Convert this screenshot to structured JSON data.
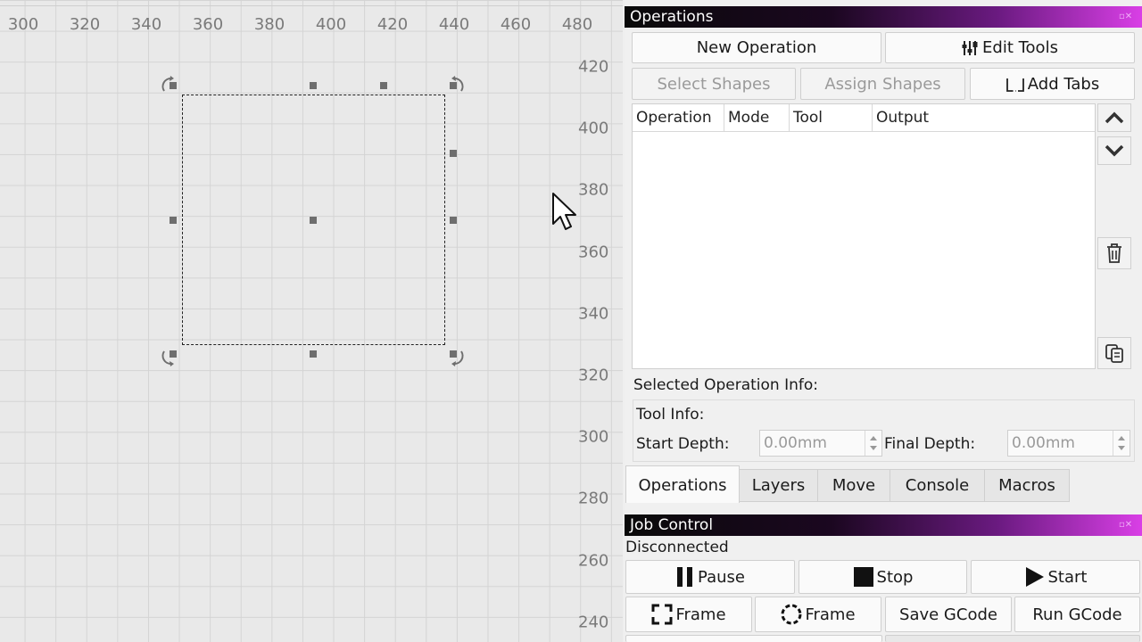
{
  "canvas": {
    "x_ticks": [
      "300",
      "320",
      "340",
      "360",
      "380",
      "400",
      "420",
      "440",
      "460",
      "480"
    ],
    "y_ticks": [
      "420",
      "400",
      "380",
      "360",
      "340",
      "320",
      "300",
      "280",
      "260",
      "240"
    ]
  },
  "operations_panel": {
    "title": "Operations",
    "new_operation": "New Operation",
    "edit_tools": "Edit Tools",
    "select_shapes": "Select Shapes",
    "assign_shapes": "Assign Shapes",
    "add_tabs": "Add Tabs",
    "columns": [
      "Operation",
      "Mode",
      "Tool",
      "Output"
    ],
    "selected_info_label": "Selected Operation Info:",
    "tool_info_label": "Tool Info:",
    "start_depth_label": "Start Depth:",
    "start_depth_value": "0.00mm",
    "final_depth_label": "Final Depth:",
    "final_depth_value": "0.00mm"
  },
  "tabs": [
    "Operations",
    "Layers",
    "Move",
    "Console",
    "Macros"
  ],
  "job_control": {
    "title": "Job Control",
    "status": "Disconnected",
    "pause": "Pause",
    "stop": "Stop",
    "start": "Start",
    "frame1": "Frame",
    "frame2": "Frame",
    "save_gcode": "Save GCode",
    "run_gcode": "Run GCode"
  },
  "colors": {
    "title_gradient_end": "#d93fe6",
    "canvas_bg": "#e9e9e9"
  }
}
